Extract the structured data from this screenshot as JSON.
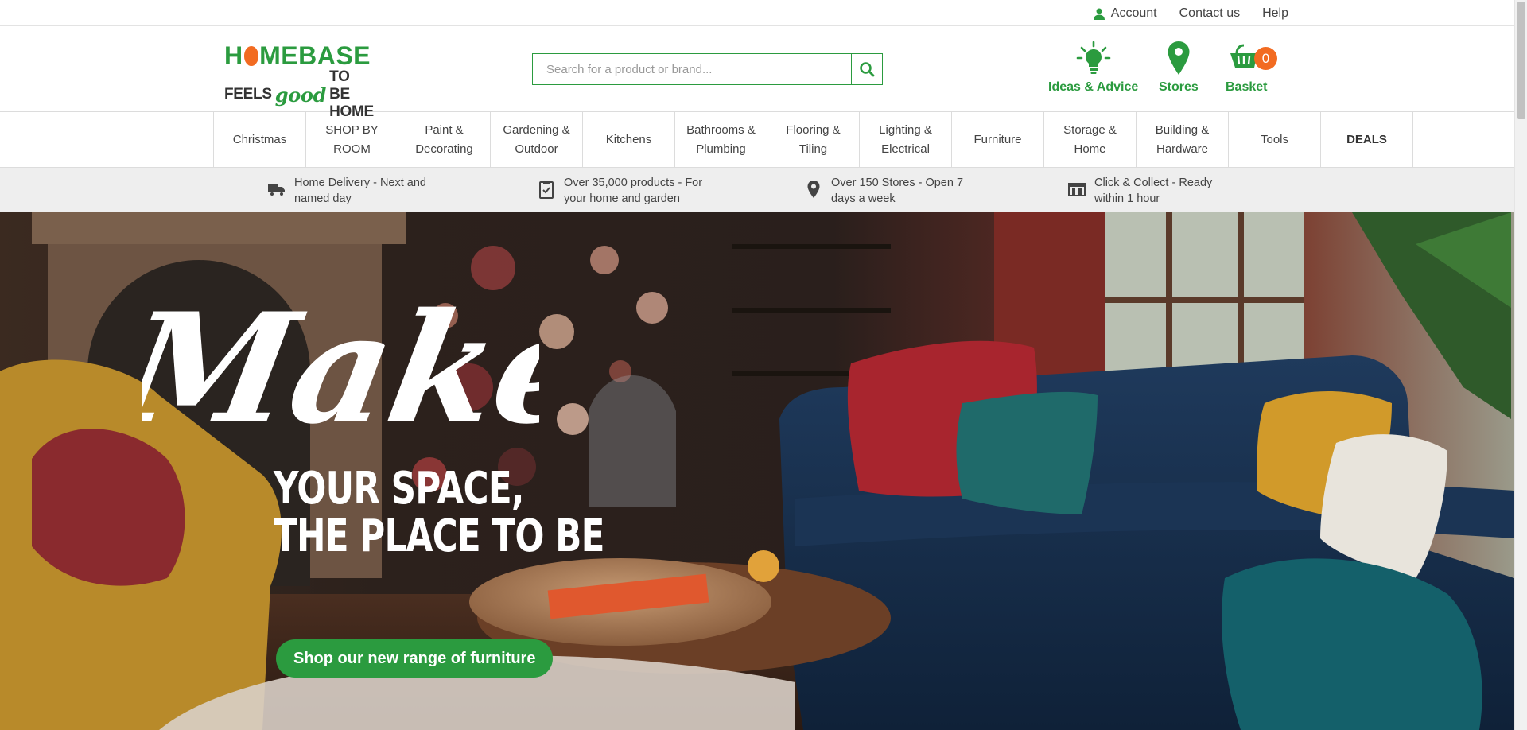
{
  "utility": {
    "account": "Account",
    "contact": "Contact us",
    "help": "Help"
  },
  "logo": {
    "word_start": "H",
    "word_end": "MEBASE",
    "tag_start": "FEELS",
    "tag_good": "good",
    "tag_end": "TO BE HOME"
  },
  "search": {
    "placeholder": "Search for a product or brand...",
    "value": ""
  },
  "header_actions": {
    "ideas": "Ideas & Advice",
    "stores": "Stores",
    "basket": "Basket",
    "basket_count": "0"
  },
  "nav": {
    "items": [
      {
        "label": "Christmas"
      },
      {
        "label": "SHOP BY ROOM"
      },
      {
        "label": "Paint & Decorating"
      },
      {
        "label": "Gardening & Outdoor"
      },
      {
        "label": "Kitchens"
      },
      {
        "label": "Bathrooms & Plumbing"
      },
      {
        "label": "Flooring & Tiling"
      },
      {
        "label": "Lighting & Electrical"
      },
      {
        "label": "Furniture"
      },
      {
        "label": "Storage & Home"
      },
      {
        "label": "Building & Hardware"
      },
      {
        "label": "Tools"
      },
      {
        "label": "DEALS"
      }
    ]
  },
  "usps": [
    {
      "icon": "delivery-truck-icon",
      "text": "Home Delivery - Next and named day"
    },
    {
      "icon": "clipboard-check-icon",
      "text": "Over 35,000 products - For your home and garden"
    },
    {
      "icon": "location-pin-icon",
      "text": "Over 150 Stores - Open 7 days a week"
    },
    {
      "icon": "store-front-icon",
      "text": "Click & Collect - Ready within 1 hour"
    }
  ],
  "hero": {
    "script_word": "Make",
    "line1": "YOUR SPACE,",
    "line2": "THE PLACE TO BE",
    "cta": "Shop our new range of furniture"
  },
  "colors": {
    "brand_green": "#2b9b3f",
    "brand_orange": "#f26b21",
    "usp_bg": "#eeeeee"
  }
}
